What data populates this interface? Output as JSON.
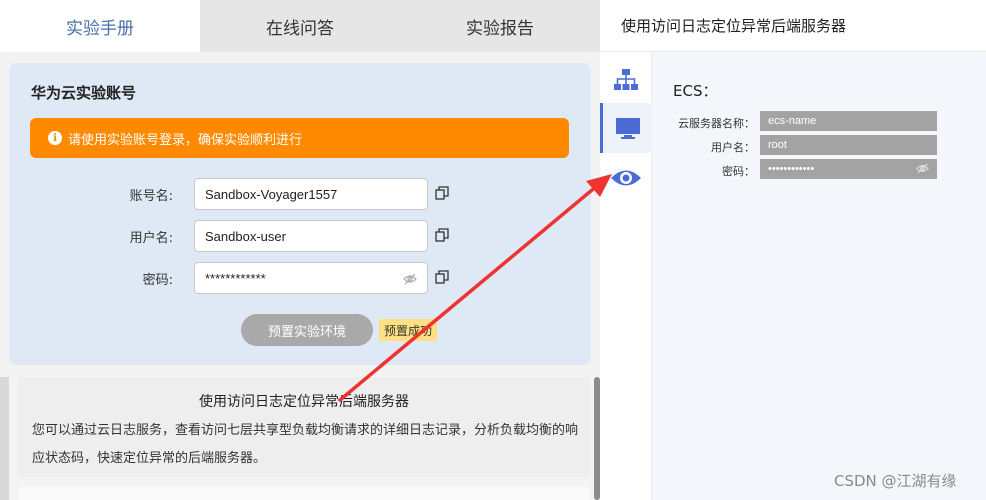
{
  "tabs": [
    {
      "label": "实验手册",
      "active": true
    },
    {
      "label": "在线问答",
      "active": false
    },
    {
      "label": "实验报告",
      "active": false
    }
  ],
  "right_header": {
    "title": "使用访问日志定位异常后端服务器"
  },
  "account": {
    "title": "华为云实验账号",
    "alert": "请使用实验账号登录，确保实验顺利进行",
    "fields": {
      "account_label": "账号名:",
      "account_value": "Sandbox-Voyager1557",
      "user_label": "用户名:",
      "user_value": "Sandbox-user",
      "password_label": "密码:",
      "password_value": "************"
    },
    "env_button": "预置实验环境",
    "status_badge": "预置成功"
  },
  "manual": {
    "title": "使用访问日志定位异常后端服务器",
    "body": "您可以通过云日志服务，查看访问七层共享型负载均衡请求的详细日志记录，分析负载均衡的响应状态码，快速定位异常的后端服务器。"
  },
  "ecs": {
    "title": "ECS：",
    "server_name_label": "云服务器名称：",
    "server_name_value": "ecs-name",
    "user_label": "用户名：",
    "user_value": "root",
    "password_label": "密码：",
    "password_value": "••••••••••••"
  },
  "watermark": "CSDN @江湖有缘",
  "colors": {
    "accent": "#4a6cd4",
    "alert": "#ff8a00",
    "badge": "#ffe082",
    "arrow": "#ee3333"
  },
  "icons": [
    "sitemap-icon",
    "monitor-icon",
    "eye-icon",
    "copy-icon",
    "eye-off-icon",
    "info-icon"
  ]
}
